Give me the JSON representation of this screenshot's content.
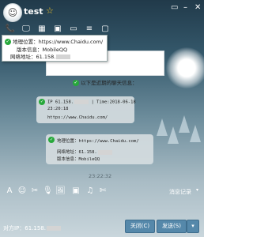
{
  "header": {
    "avatar_glyph": "☺",
    "contact_name": "test",
    "star_icon": "☆",
    "menu_icon": "▭",
    "minimize_icon": "–",
    "close_icon": "✕"
  },
  "toolbar": {
    "icons": [
      "📞",
      "🖵",
      "▦",
      "▣",
      "▭",
      "≡",
      "▢"
    ]
  },
  "ip_popup": {
    "location_label": "地理位置：",
    "location_value": "https://www.Chaidu.com/",
    "version_label": "版本信息：",
    "version_value": "MobileQQ",
    "ip_label": "网络地址：",
    "ip_value": "61.158."
  },
  "chat": {
    "notice": "以下是近期的聊天信息：",
    "bubble1": {
      "line1": "IP 61.158.",
      "line1_suffix": "| Time:2018-06-18",
      "line2": "23:20:18",
      "line3": "https://www.Chaidu.com/"
    },
    "bubble2": {
      "location_label": "地理位置：",
      "location_value": "https://www.Chaidu.com/",
      "ip_label": "网络地址：",
      "ip_value": "61.158.",
      "version_label": "版本信息：",
      "version_value": "MobileQQ"
    },
    "timestamp": "23:22:32"
  },
  "input_toolbar": {
    "icons": [
      "A",
      "☺",
      "✂",
      "🎙",
      "🖼",
      "▣",
      "♫",
      "✄"
    ],
    "history_label": "消息记录",
    "history_arrow": "▾"
  },
  "footer": {
    "ip_label": "对方IP：",
    "ip_value": "61.158.",
    "close_label": "关闭(C)",
    "send_label": "发送(S)",
    "send_arrow": "▾"
  }
}
